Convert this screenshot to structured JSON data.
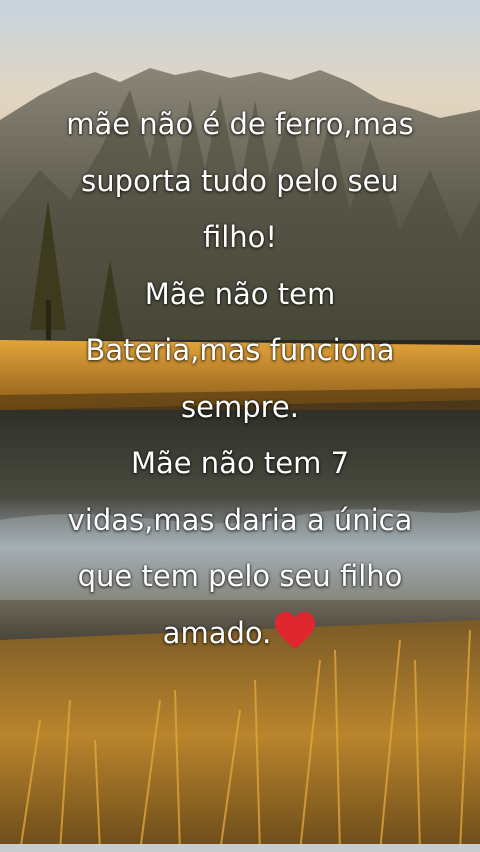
{
  "caption": {
    "lines": [
      "mãe não é de ferro,mas",
      "suporta tudo pelo seu",
      "filho!",
      "Mãe não tem",
      "Bateria,mas funciona",
      "sempre.",
      "Mãe não tem 7",
      "vidas,mas daria a única",
      "que tem pelo seu filho",
      "amado."
    ],
    "emoji": "heart-icon"
  },
  "colors": {
    "sky": "#b8c7d3",
    "mountain": "#6f6a5a",
    "grass": "#d79a2c",
    "water": "#3a3a34",
    "heart": "#e0262f"
  }
}
